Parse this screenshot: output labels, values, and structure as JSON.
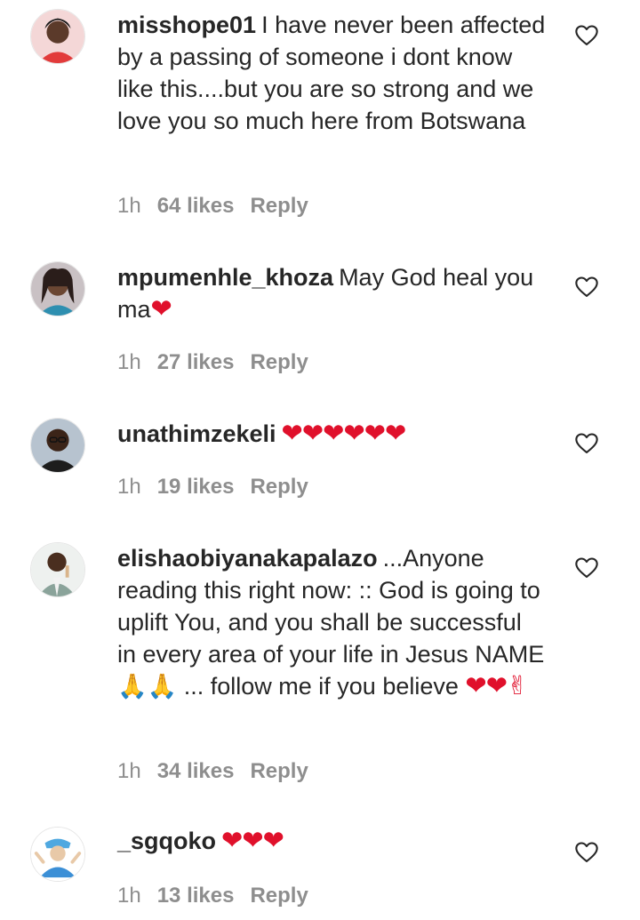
{
  "comments": [
    {
      "username": "misshope01",
      "text": "I have never been affected by a passing of someone i dont know like this....but you are so strong and we love you so much here from Botswana",
      "time": "1h",
      "likes": "64 likes",
      "reply": "Reply",
      "avatar": "avatar-woman-red-top"
    },
    {
      "username": "mpumenhle_khoza",
      "text": "May God heal you ma",
      "emoji": "❤",
      "time": "1h",
      "likes": "27 likes",
      "reply": "Reply",
      "avatar": "avatar-woman-braids"
    },
    {
      "username": "unathimzekeli",
      "text": "",
      "emoji": "❤❤❤❤❤❤",
      "time": "1h",
      "likes": "19 likes",
      "reply": "Reply",
      "avatar": "avatar-man-glasses"
    },
    {
      "username": "elishaobiyanakapalazo",
      "text": "...Anyone reading this right now: :: God is going to uplift You, and you shall be successful in every area of your life in Jesus NAME 🙏🙏 ... follow me if you believe",
      "emoji": "❤❤✌",
      "time": "1h",
      "likes": "34 likes",
      "reply": "Reply",
      "avatar": "avatar-man-suit"
    },
    {
      "username": "_sgqoko",
      "text": "",
      "emoji": "❤❤❤",
      "time": "1h",
      "likes": "13 likes",
      "reply": "Reply",
      "avatar": "avatar-cartoon-character"
    }
  ],
  "colors": {
    "text": "#262626",
    "meta": "#8e8e8e",
    "heart_red": "#e0102b"
  },
  "icons": {
    "like": "heart-outline-icon"
  }
}
